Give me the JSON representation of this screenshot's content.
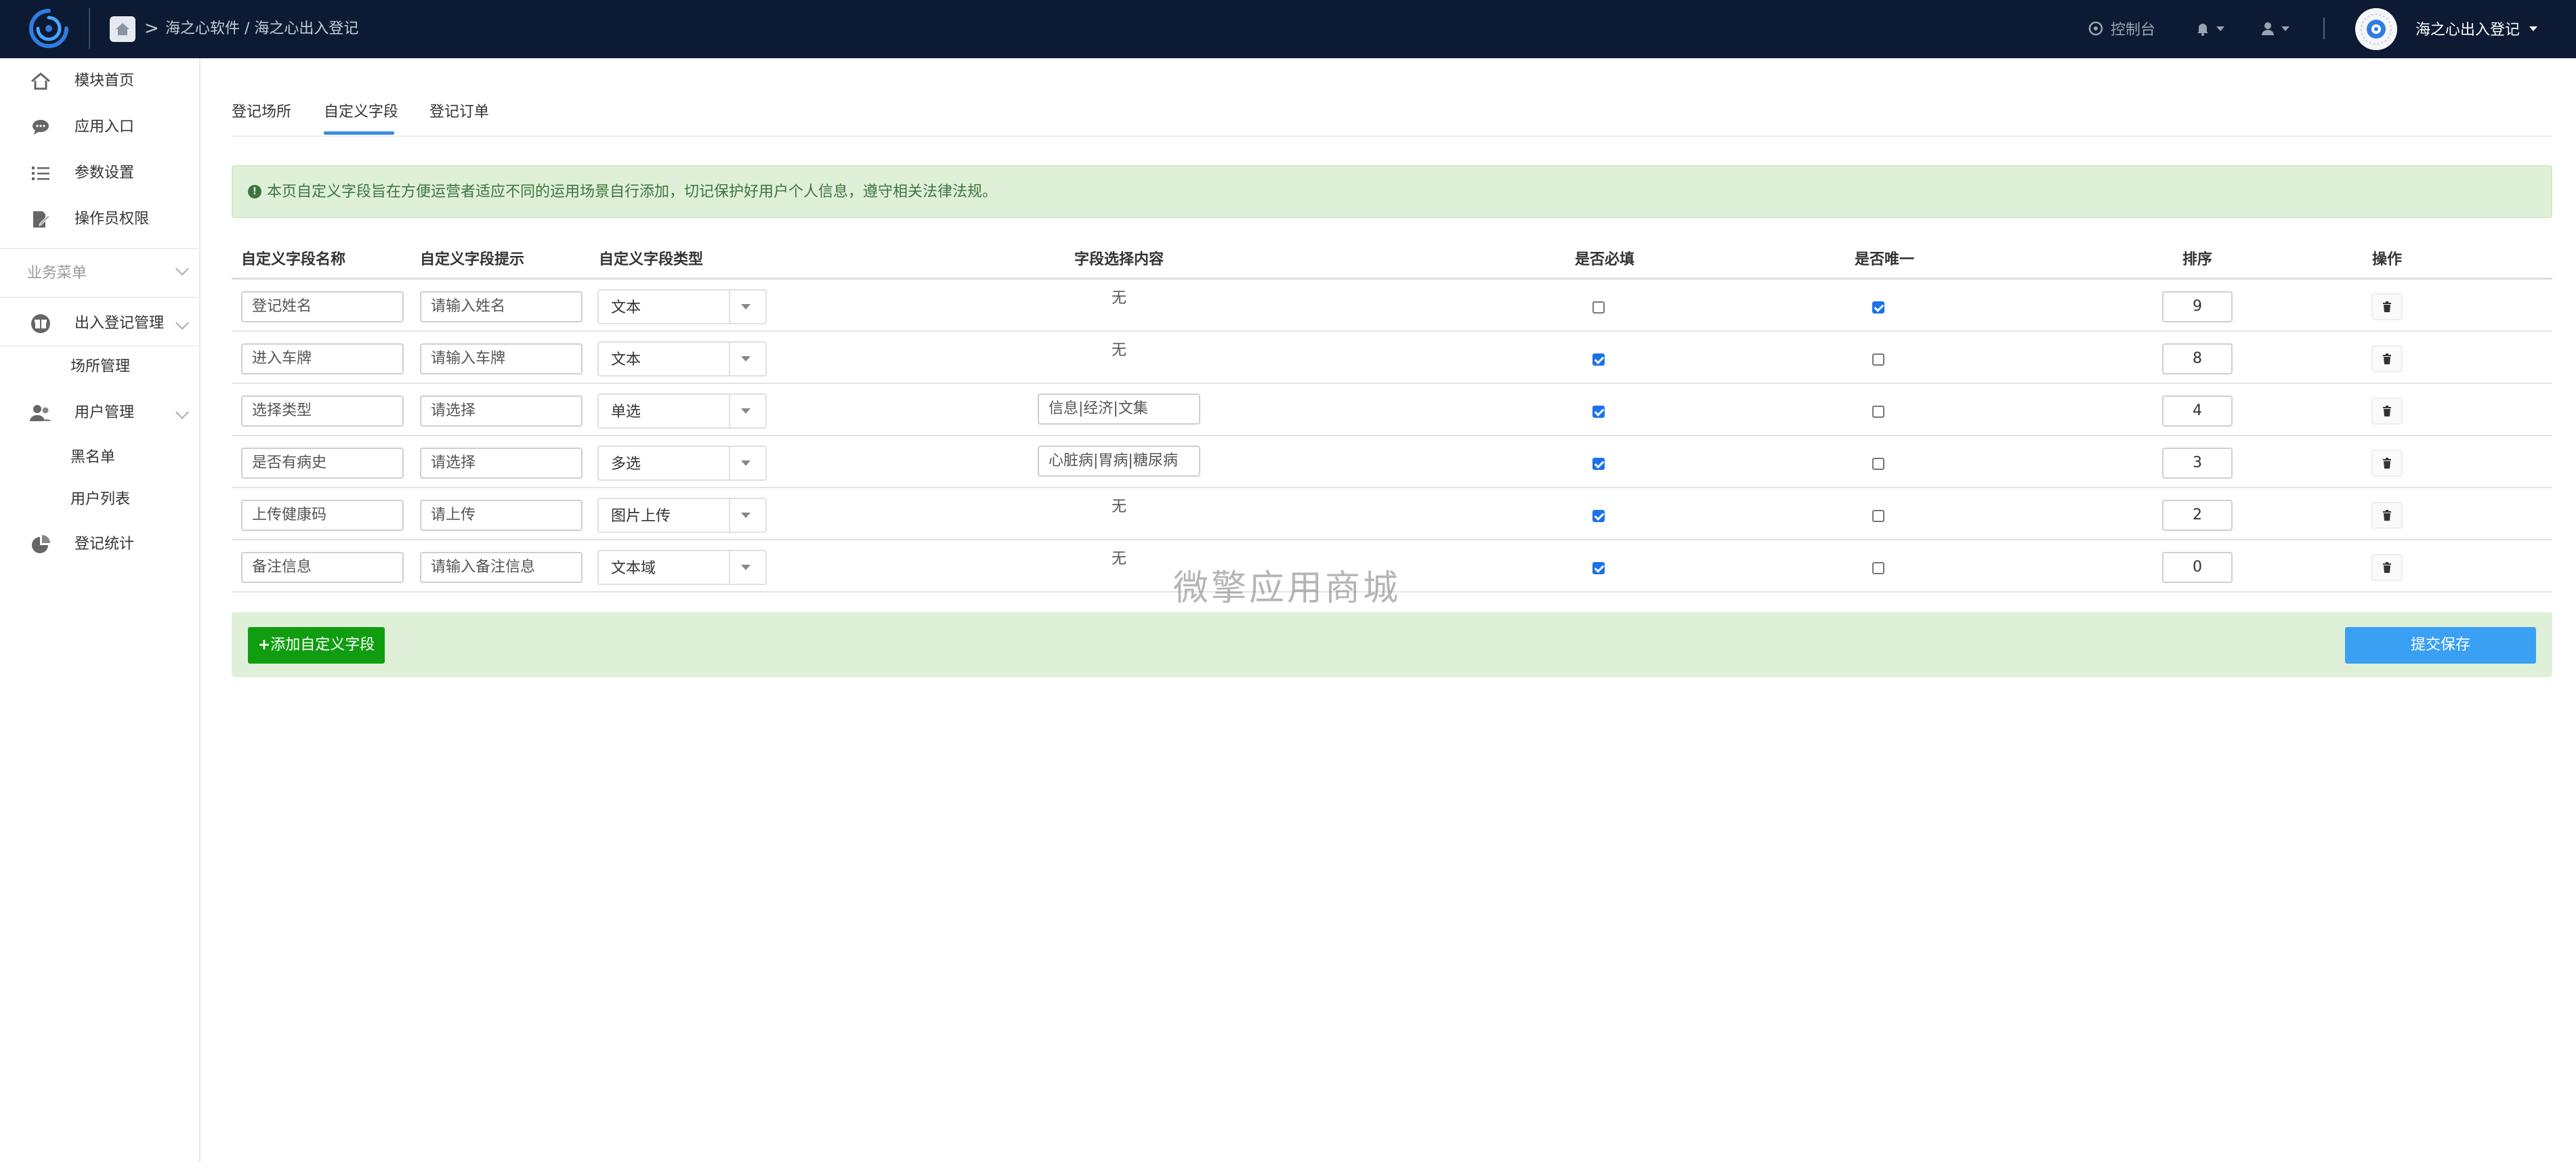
{
  "topbar": {
    "breadcrumb_sep": ">",
    "breadcrumb": "海之心软件 / 海之心出入登记",
    "console_label": "控制台",
    "account_name": "海之心出入登记"
  },
  "sidebar": {
    "items": [
      {
        "label": "模块首页",
        "icon": "home-icon"
      },
      {
        "label": "应用入口",
        "icon": "chat-icon"
      },
      {
        "label": "参数设置",
        "icon": "list-icon"
      },
      {
        "label": "操作员权限",
        "icon": "edit-doc-icon"
      }
    ],
    "section_title": "业务菜单",
    "group1": {
      "label": "出入登记管理",
      "icon": "gift-icon"
    },
    "group1_sub": [
      "场所管理"
    ],
    "group2": {
      "label": "用户管理",
      "icon": "users-icon"
    },
    "group2_sub": [
      "黑名单",
      "用户列表"
    ],
    "stats": {
      "label": "登记统计",
      "icon": "pie-chart-icon"
    }
  },
  "tabs": [
    {
      "label": "登记场所"
    },
    {
      "label": "自定义字段",
      "active": true
    },
    {
      "label": "登记订单"
    }
  ],
  "alert": {
    "text": "本页自定义字段旨在方便运营者适应不同的运用场景自行添加，切记保护好用户个人信息，遵守相关法律法规。"
  },
  "table": {
    "headers": [
      "自定义字段名称",
      "自定义字段提示",
      "自定义字段类型",
      "字段选择内容",
      "是否必填",
      "是否唯一",
      "排序",
      "操作"
    ],
    "rows": [
      {
        "name": "登记姓名",
        "hint": "请输入姓名",
        "type": "文本",
        "options": "无",
        "required": false,
        "unique": true,
        "sort": "9"
      },
      {
        "name": "进入车牌",
        "hint": "请输入车牌",
        "type": "文本",
        "options": "无",
        "required": true,
        "unique": false,
        "sort": "8"
      },
      {
        "name": "选择类型",
        "hint": "请选择",
        "type": "单选",
        "options": "信息|经济|文集",
        "required": true,
        "unique": false,
        "sort": "4"
      },
      {
        "name": "是否有病史",
        "hint": "请选择",
        "type": "多选",
        "options": "心脏病|胃病|糖尿病",
        "required": true,
        "unique": false,
        "sort": "3"
      },
      {
        "name": "上传健康码",
        "hint": "请上传",
        "type": "图片上传",
        "options": "无",
        "required": true,
        "unique": false,
        "sort": "2"
      },
      {
        "name": "备注信息",
        "hint": "请输入备注信息",
        "type": "文本域",
        "options": "无",
        "required": true,
        "unique": false,
        "sort": "0"
      }
    ]
  },
  "actions": {
    "add_label": "添加自定义字段",
    "save_label": "提交保存"
  },
  "watermark": "微擎应用商城",
  "colors": {
    "topbar": "#0c1a33",
    "accent": "#3a8ee6",
    "success_bg": "#dff0d8",
    "add_button": "#109d10",
    "save_button": "#3aa0f3"
  }
}
